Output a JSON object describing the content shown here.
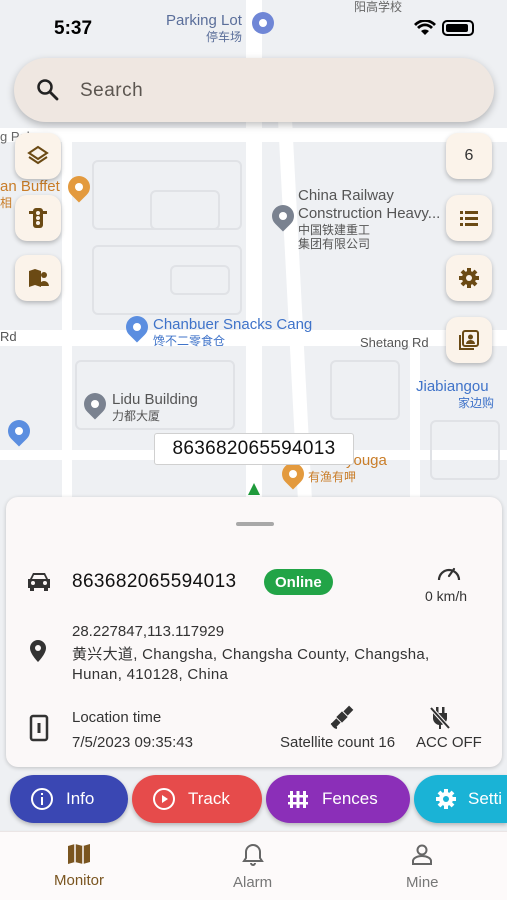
{
  "status_bar": {
    "time": "5:37"
  },
  "map": {
    "pois": [
      {
        "en": "Parking Lot",
        "zh": "停车场",
        "id": "parking"
      },
      {
        "en": "China Railway",
        "en2": "Construction Heavy...",
        "zh": "中国铁建重工",
        "zh2": "集团有限公司",
        "id": "railway"
      },
      {
        "en": "Chanbuer Snacks Cang",
        "zh": "馋不二零食仓",
        "id": "chanbuer"
      },
      {
        "en": "Lidu Building",
        "zh": "力都大厦",
        "id": "lidu"
      },
      {
        "en": "Jiabiangou",
        "zh": "家边购",
        "id": "jiabiangou"
      },
      {
        "en": "Youyouga",
        "zh": "有渔有呷",
        "id": "youyouga"
      }
    ],
    "fragments": {
      "buffet": "an Buffet",
      "buffet_zh": "相",
      "g_poly": "g Poly",
      "rd_left": "Rd",
      "shetang": "Shetang Rd",
      "school_zh": "阳高学校"
    },
    "device_label": "863682065594013",
    "right_count": "6"
  },
  "search": {
    "placeholder": "Search"
  },
  "panel": {
    "device_id": "863682065594013",
    "status": "Online",
    "speed": "0 km/h",
    "coords": "28.227847,113.117929",
    "address": "黄兴大道, Changsha, Changsha County, Changsha, Hunan, 410128, China",
    "location_time_label": "Location time",
    "location_time": "7/5/2023 09:35:43",
    "satellite": "Satellite count 16",
    "acc": "ACC OFF"
  },
  "actions": [
    {
      "label": "Info",
      "color": "#3a47b3"
    },
    {
      "label": "Track",
      "color": "#e64b4b"
    },
    {
      "label": "Fences",
      "color": "#8b2fb8"
    },
    {
      "label": "Setti",
      "color": "#1ab3d6"
    }
  ],
  "bottom_nav": {
    "monitor": "Monitor",
    "alarm": "Alarm",
    "mine": "Mine",
    "active_color": "#7a5520"
  }
}
